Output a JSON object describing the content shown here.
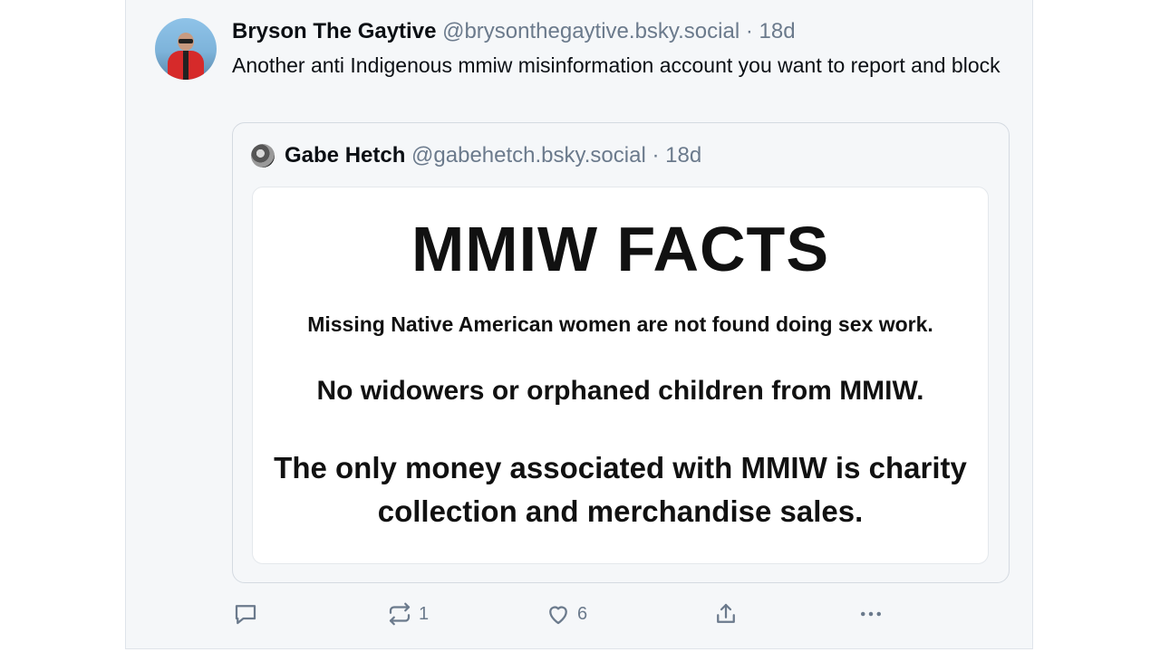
{
  "post": {
    "author_name": "Bryson The Gaytive",
    "author_handle": "@brysonthegaytive.bsky.social",
    "separator": "·",
    "time": "18d",
    "text": "Another anti Indigenous mmiw misinformation account you want to report and block"
  },
  "quote": {
    "author_name": "Gabe Hetch",
    "author_handle": "@gabehetch.bsky.social",
    "separator": "·",
    "time": "18d",
    "image": {
      "title": "MMIW FACTS",
      "line1": "Missing Native American women are not found doing sex work.",
      "line2": "No widowers or orphaned children from MMIW.",
      "line3": "The only money associated with MMIW is charity collection and merchandise sales."
    }
  },
  "actions": {
    "reply_icon": "comment-icon",
    "repost_icon": "repost-icon",
    "repost_count": "1",
    "like_icon": "heart-icon",
    "like_count": "6",
    "share_icon": "share-icon",
    "more_icon": "more-icon"
  },
  "colors": {
    "background": "#f5f7f9",
    "text": "#0b0f14",
    "muted": "#6b7a8c",
    "border": "#d4dae1"
  }
}
